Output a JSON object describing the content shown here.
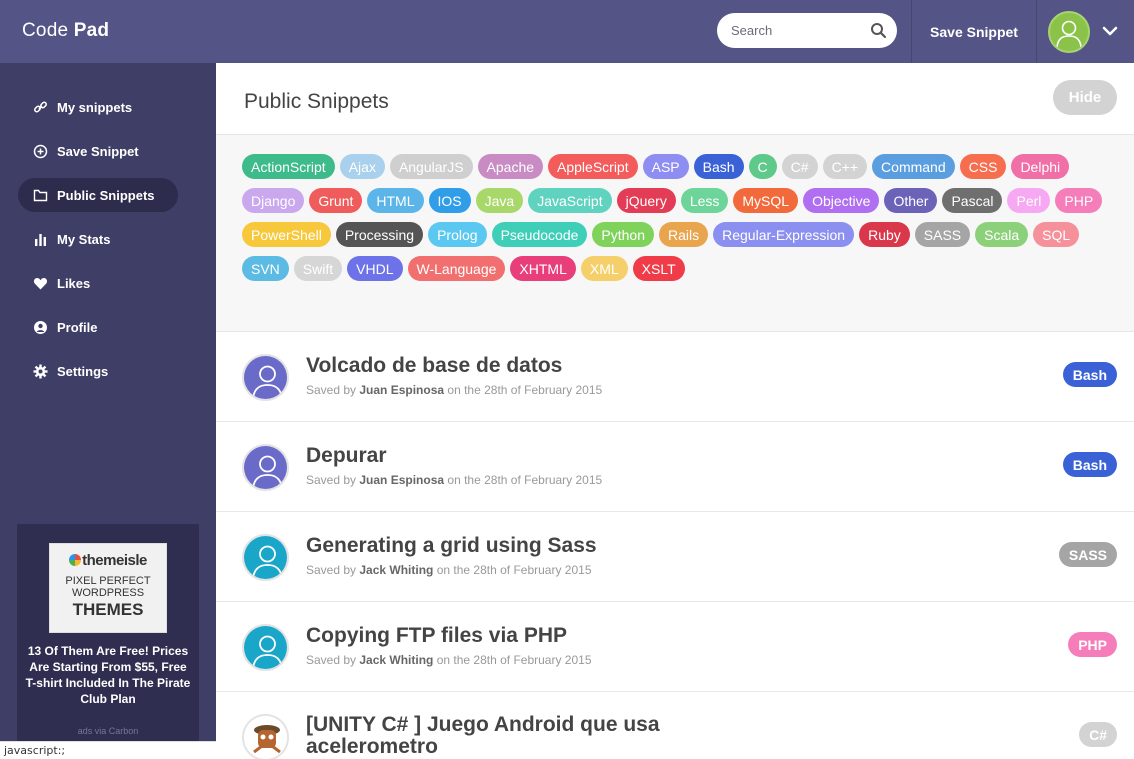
{
  "header": {
    "brand_light": "Code",
    "brand_bold": "Pad",
    "search_placeholder": "Search",
    "save_label": "Save Snippet"
  },
  "sidebar": {
    "items": [
      {
        "label": "My snippets",
        "icon": "link-icon"
      },
      {
        "label": "Save Snippet",
        "icon": "plus-circle-icon"
      },
      {
        "label": "Public Snippets",
        "icon": "folder-icon",
        "active": true
      },
      {
        "label": "My Stats",
        "icon": "bar-chart-icon"
      },
      {
        "label": "Likes",
        "icon": "heart-icon"
      },
      {
        "label": "Profile",
        "icon": "user-circle-icon"
      },
      {
        "label": "Settings",
        "icon": "gear-icon"
      }
    ],
    "ad": {
      "brand": "themeisle",
      "line1": "PIXEL PERFECT",
      "line2": "WORDPRESS",
      "line3": "THEMES",
      "text": "13 Of Them Are Free! Prices Are Starting From $55, Free T-shirt Included In The Pirate Club Plan",
      "via": "ads via Carbon"
    }
  },
  "main": {
    "title": "Public Snippets",
    "hide_label": "Hide",
    "tags": [
      {
        "label": "ActionScript",
        "color": "#3dbb8a"
      },
      {
        "label": "Ajax",
        "color": "#a9d0ec"
      },
      {
        "label": "AngularJS",
        "color": "#cfcfcf"
      },
      {
        "label": "Apache",
        "color": "#c98bc4"
      },
      {
        "label": "AppleScript",
        "color": "#f45b5b"
      },
      {
        "label": "ASP",
        "color": "#8e8ef2"
      },
      {
        "label": "Bash",
        "color": "#3a61d6"
      },
      {
        "label": "C",
        "color": "#5ec98a"
      },
      {
        "label": "C#",
        "color": "#d3d3d3"
      },
      {
        "label": "C++",
        "color": "#d3d3d3"
      },
      {
        "label": "Command",
        "color": "#5b9ee0"
      },
      {
        "label": "CSS",
        "color": "#f76e4f"
      },
      {
        "label": "Delphi",
        "color": "#f06fa7"
      },
      {
        "label": "Django",
        "color": "#c9a8ee"
      },
      {
        "label": "Grunt",
        "color": "#f05b5b"
      },
      {
        "label": "HTML",
        "color": "#5bb5e8"
      },
      {
        "label": "IOS",
        "color": "#2f9de8"
      },
      {
        "label": "Java",
        "color": "#a8d86a"
      },
      {
        "label": "JavaScript",
        "color": "#5fd3c0"
      },
      {
        "label": "jQuery",
        "color": "#e33c56"
      },
      {
        "label": "Less",
        "color": "#6dd49a"
      },
      {
        "label": "MySQL",
        "color": "#f26a3b"
      },
      {
        "label": "Objective",
        "color": "#b06ef0"
      },
      {
        "label": "Other",
        "color": "#6b63b8"
      },
      {
        "label": "Pascal",
        "color": "#6f6f6f"
      },
      {
        "label": "Perl",
        "color": "#f7a8f2"
      },
      {
        "label": "PHP",
        "color": "#f57dba"
      },
      {
        "label": "PowerShell",
        "color": "#f7c83b"
      },
      {
        "label": "Processing",
        "color": "#555555"
      },
      {
        "label": "Prolog",
        "color": "#5bc8f2"
      },
      {
        "label": "Pseudocode",
        "color": "#3fcfb9"
      },
      {
        "label": "Python",
        "color": "#7fd25a"
      },
      {
        "label": "Rails",
        "color": "#e9a54d"
      },
      {
        "label": "Regular-Expression",
        "color": "#8b8ff0"
      },
      {
        "label": "Ruby",
        "color": "#d9374a"
      },
      {
        "label": "SASS",
        "color": "#a5a5a5"
      },
      {
        "label": "Scala",
        "color": "#8cd17a"
      },
      {
        "label": "SQL",
        "color": "#f6919b"
      },
      {
        "label": "SVN",
        "color": "#5bbbe3"
      },
      {
        "label": "Swift",
        "color": "#d6d6d6"
      },
      {
        "label": "VHDL",
        "color": "#6d72e8"
      },
      {
        "label": "W-Language",
        "color": "#f26f6f"
      },
      {
        "label": "XHTML",
        "color": "#e83f7a"
      },
      {
        "label": "XML",
        "color": "#f5d06a"
      },
      {
        "label": "XSLT",
        "color": "#f03c48"
      }
    ],
    "snippets": [
      {
        "title": "Volcado de base de datos",
        "saved_by": "Saved by",
        "author": "Juan Espinosa",
        "date": "on the 28th of February 2015",
        "tag": "Bash",
        "tag_color": "#3a61d6",
        "avatar_color": "#6a6ac9"
      },
      {
        "title": "Depurar",
        "saved_by": "Saved by",
        "author": "Juan Espinosa",
        "date": "on the 28th of February 2015",
        "tag": "Bash",
        "tag_color": "#3a61d6",
        "avatar_color": "#6a6ac9"
      },
      {
        "title": "Generating a grid using Sass",
        "saved_by": "Saved by",
        "author": "Jack Whiting",
        "date": "on the 28th of February 2015",
        "tag": "SASS",
        "tag_color": "#a5a5a5",
        "avatar_color": "#19a6c9"
      },
      {
        "title": "Copying FTP files via PHP",
        "saved_by": "Saved by",
        "author": "Jack Whiting",
        "date": "on the 28th of February 2015",
        "tag": "PHP",
        "tag_color": "#f57dba",
        "avatar_color": "#19a6c9"
      },
      {
        "title": "[UNITY C# ] Juego Android que usa acelerometro",
        "saved_by": "",
        "author": "",
        "date": "",
        "tag": "C#",
        "tag_color": "#d3d3d3",
        "avatar_color": "#ffffff"
      }
    ]
  },
  "statusbar": {
    "text": "javascript:;"
  }
}
